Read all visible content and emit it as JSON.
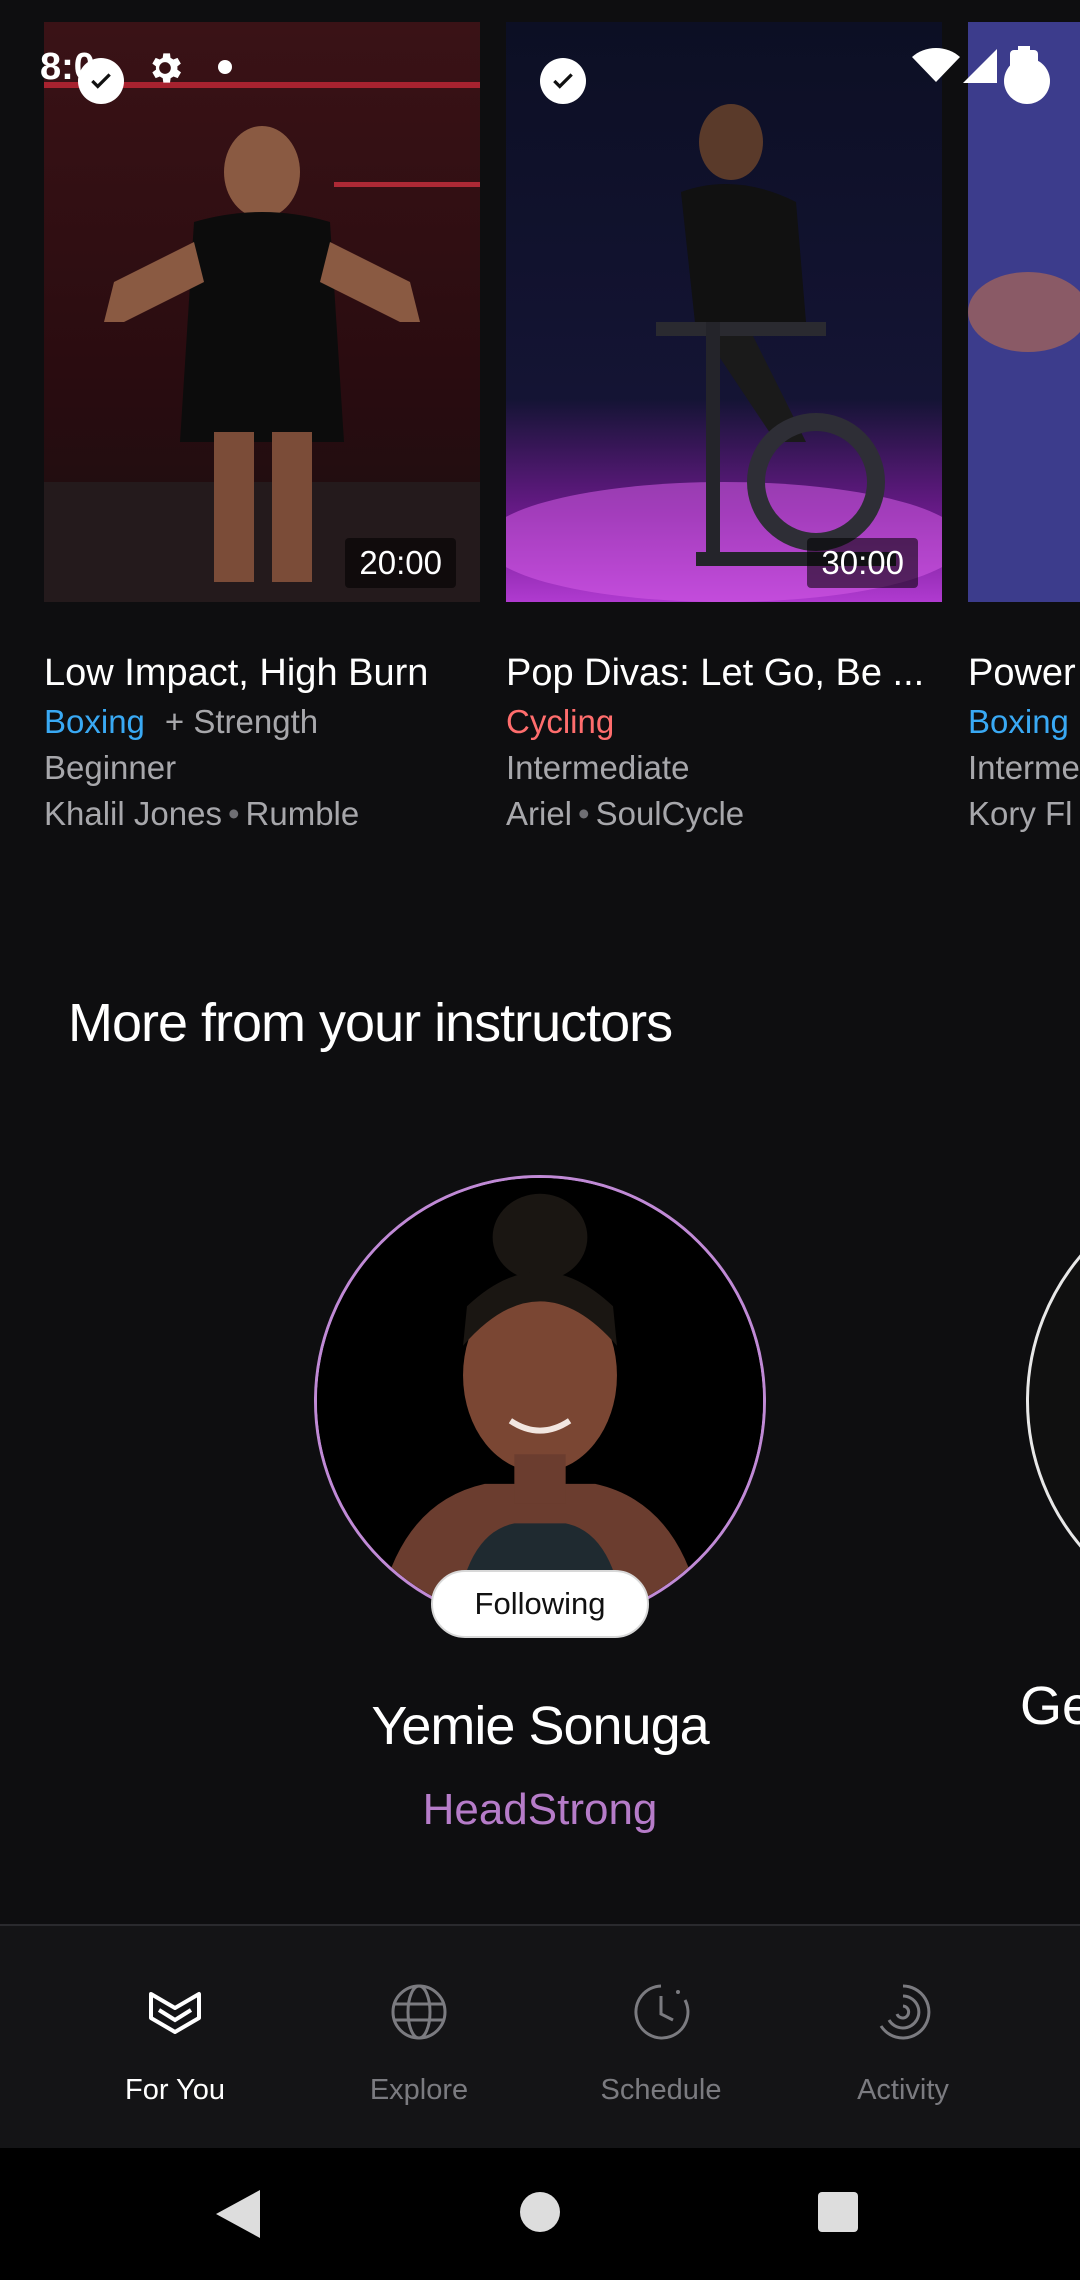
{
  "status_bar": {
    "time": "8:0"
  },
  "cards": [
    {
      "title": "Low Impact, High Burn",
      "category": "Boxing",
      "category_color": "#39a9f4",
      "extra": "+ Strength",
      "level": "Beginner",
      "instructor": "Khalil Jones",
      "brand": "Rumble",
      "duration": "20:00",
      "completed": true
    },
    {
      "title": "Pop Divas: Let Go, Be ...",
      "category": "Cycling",
      "category_color": "#ff6d6d",
      "level": "Intermediate",
      "instructor": "Ariel",
      "brand": "SoulCycle",
      "duration": "30:00",
      "completed": true
    },
    {
      "title": "Power",
      "category": "Boxing",
      "category_color": "#39a9f4",
      "level": "Interme",
      "instructor": "Kory Fl",
      "completed": true
    }
  ],
  "section": {
    "title": "More from your instructors"
  },
  "instructors": [
    {
      "name": "Yemie Sonuga",
      "program": "HeadStrong",
      "follow_label": "Following"
    },
    {
      "name": "Ge"
    }
  ],
  "bottom_nav": {
    "items": [
      {
        "label": "For You",
        "icon": "for-you-icon",
        "active": true
      },
      {
        "label": "Explore",
        "icon": "globe-icon",
        "active": false
      },
      {
        "label": "Schedule",
        "icon": "clock-icon",
        "active": false
      },
      {
        "label": "Activity",
        "icon": "activity-icon",
        "active": false
      }
    ]
  },
  "colors": {
    "background": "#0e0e10",
    "boxing": "#39a9f4",
    "cycling": "#ff6d6d",
    "program": "#b67cc9"
  }
}
